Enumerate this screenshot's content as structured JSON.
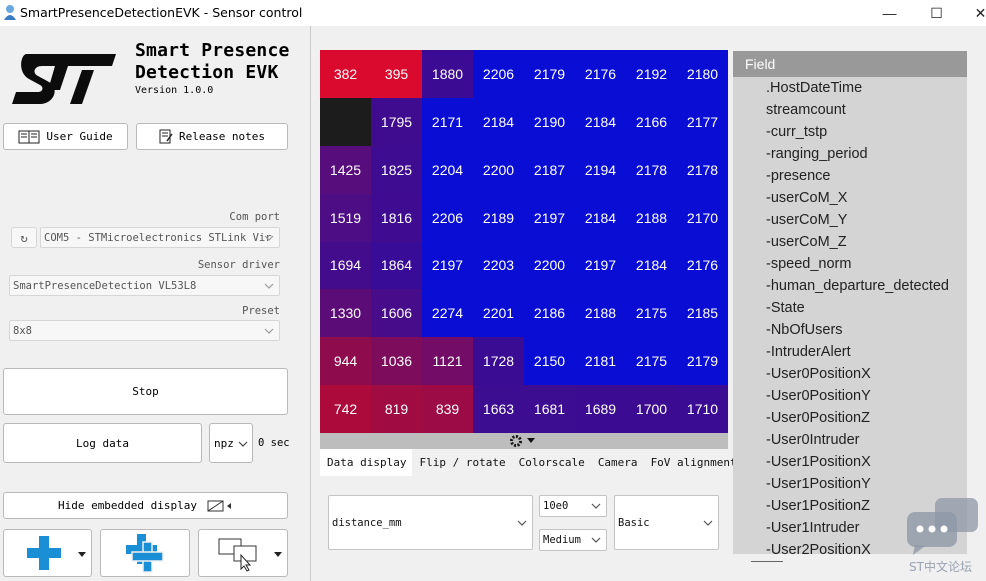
{
  "window": {
    "title": "SmartPresenceDetectionEVK - Sensor control",
    "controls": {
      "minimize": "—",
      "maximize": "☐",
      "close": "✕"
    }
  },
  "brand": {
    "title_line1": "Smart Presence",
    "title_line2": "Detection EVK",
    "version": "Version 1.0.0",
    "logo_color": "#0c0c0c"
  },
  "left": {
    "user_guide": "User Guide",
    "release_notes": "Release notes",
    "com_port_label": "Com port",
    "com_port_value": "COM5 - STMicroelectronics STLink Vir",
    "sensor_driver_label": "Sensor driver",
    "sensor_driver_value": "SmartPresenceDetection VL53L8",
    "preset_label": "Preset",
    "preset_value": "8x8",
    "stop_button": "Stop",
    "log_button": "Log data",
    "log_format": "npz",
    "log_time": "0 sec",
    "hide_display_button": "Hide embedded display"
  },
  "heatmap": {
    "rows": [
      [
        382,
        395,
        1880,
        2206,
        2179,
        2176,
        2192,
        2180
      ],
      [
        null,
        1795,
        2171,
        2184,
        2190,
        2184,
        2166,
        2177
      ],
      [
        1425,
        1825,
        2204,
        2200,
        2187,
        2194,
        2178,
        2178
      ],
      [
        1519,
        1816,
        2206,
        2189,
        2197,
        2184,
        2188,
        2170
      ],
      [
        1694,
        1864,
        2197,
        2203,
        2200,
        2197,
        2184,
        2176
      ],
      [
        1330,
        1606,
        2274,
        2201,
        2186,
        2188,
        2175,
        2185
      ],
      [
        944,
        1036,
        1121,
        1728,
        2150,
        2181,
        2175,
        2179
      ],
      [
        742,
        819,
        839,
        1663,
        1681,
        1689,
        1700,
        1710
      ]
    ],
    "colors": [
      [
        "#d90a2e",
        "#d90a2e",
        "#3b0b93",
        "#0a0ed4",
        "#0a0ed4",
        "#0a0ed4",
        "#0a0ed4",
        "#0a0ed4"
      ],
      [
        "#1c1c1c",
        "#400c8f",
        "#0a0ed4",
        "#0a0ed4",
        "#0a0ed4",
        "#0a0ed4",
        "#0a0ed4",
        "#0a0ed4"
      ],
      [
        "#570d7c",
        "#3e0c91",
        "#0a0ed4",
        "#0a0ed4",
        "#0a0ed4",
        "#0a0ed4",
        "#0a0ed4",
        "#0a0ed4"
      ],
      [
        "#4d0e85",
        "#3f0c91",
        "#0a0ed4",
        "#0a0ed4",
        "#0a0ed4",
        "#0a0ed4",
        "#0a0ed4",
        "#0a0ed4"
      ],
      [
        "#430c8c",
        "#380c96",
        "#0a0ed4",
        "#0a0ed4",
        "#0a0ed4",
        "#0a0ed4",
        "#0a0ed4",
        "#0a0ed4"
      ],
      [
        "#5c0c77",
        "#470c8a",
        "#0a0ed4",
        "#0a0ed4",
        "#0a0ed4",
        "#0a0ed4",
        "#0a0ed4",
        "#0a0ed4"
      ],
      [
        "#8e0b4e",
        "#7e0c5c",
        "#720c66",
        "#3a0c93",
        "#0a0ed4",
        "#0a0ed4",
        "#0a0ed4",
        "#0a0ed4"
      ],
      [
        "#ab0a3a",
        "#a00b42",
        "#9c0b45",
        "#3c0c91",
        "#3c0c91",
        "#3b0c92",
        "#3b0c92",
        "#3a0c93"
      ]
    ]
  },
  "tabs": [
    "Data display",
    "Flip / rotate",
    "Colorscale",
    "Camera",
    "FoV alignment"
  ],
  "data_display": {
    "field_select": "distance_mm",
    "scale_select": "10e0",
    "size_select": "Medium",
    "mode_select": "Basic"
  },
  "fields": {
    "header": "Field",
    "items": [
      ".HostDateTime",
      "streamcount",
      "-curr_tstp",
      "-ranging_period",
      "-presence",
      "-userCoM_X",
      "-userCoM_Y",
      "-userCoM_Z",
      "-speed_norm",
      "-human_departure_detected",
      "-State",
      "-NbOfUsers",
      "-IntruderAlert",
      "-User0PositionX",
      "-User0PositionY",
      "-User0PositionZ",
      "-User0Intruder",
      "-User1PositionX",
      "-User1PositionY",
      "-User1PositionZ",
      "-User1Intruder",
      "-User2PositionX"
    ]
  },
  "watermark": "ST中文论坛",
  "accent": "#1a8fd6"
}
